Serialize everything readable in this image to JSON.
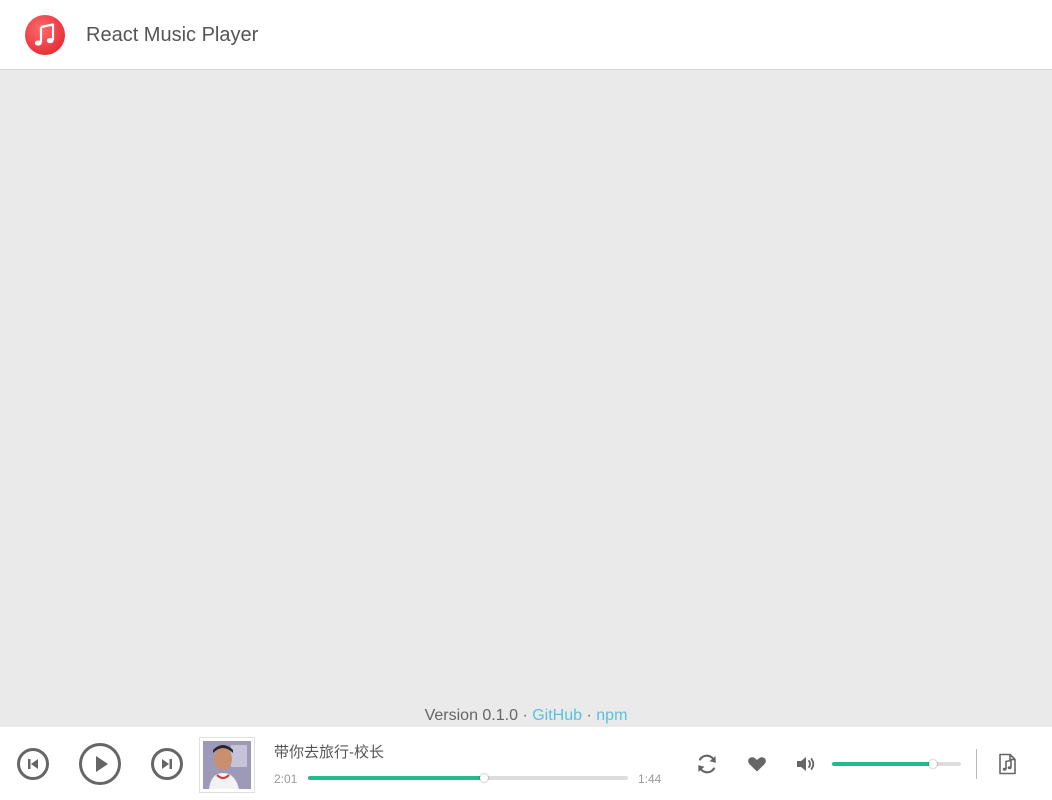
{
  "header": {
    "title": "React Music Player",
    "logo_icon": "music-note-icon",
    "logo_color": "#e8323c"
  },
  "footer": {
    "version": "Version 0.1.0",
    "separator": "·",
    "github_label": "GitHub",
    "npm_label": "npm",
    "link_color": "#5bc0de"
  },
  "player": {
    "song_title": "带你去旅行-校长",
    "time_elapsed": "2:01",
    "time_total": "1:44",
    "progress_fraction": 0.55,
    "volume_fraction": 0.78,
    "accent_color": "#22bb8b",
    "controls": {
      "prev_icon": "skip-previous-icon",
      "play_icon": "play-icon",
      "next_icon": "skip-next-icon",
      "repeat_icon": "repeat-icon",
      "like_icon": "heart-icon",
      "volume_icon": "volume-icon",
      "playlist_icon": "playlist-icon"
    }
  }
}
